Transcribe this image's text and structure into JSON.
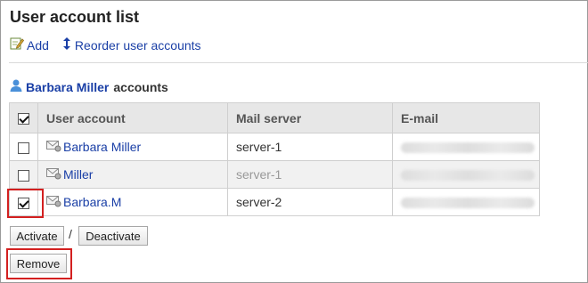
{
  "page": {
    "title": "User account list"
  },
  "actions": {
    "add": "Add",
    "reorder": "Reorder user accounts"
  },
  "owner": {
    "name": "Barbara Miller",
    "suffix": "accounts"
  },
  "table": {
    "headers": {
      "user_account": "User account",
      "mail_server": "Mail server",
      "email": "E-mail"
    },
    "rows": [
      {
        "user_account": "Barbara Miller",
        "mail_server": "server-1",
        "checked": false
      },
      {
        "user_account": "Miller",
        "mail_server": "server-1",
        "checked": false
      },
      {
        "user_account": "Barbara.M",
        "mail_server": "server-2",
        "checked": true
      }
    ]
  },
  "buttons": {
    "activate": "Activate",
    "separator": "/",
    "deactivate": "Deactivate",
    "remove": "Remove"
  },
  "colors": {
    "link": "#1a3fa6",
    "highlight": "#d32020"
  }
}
